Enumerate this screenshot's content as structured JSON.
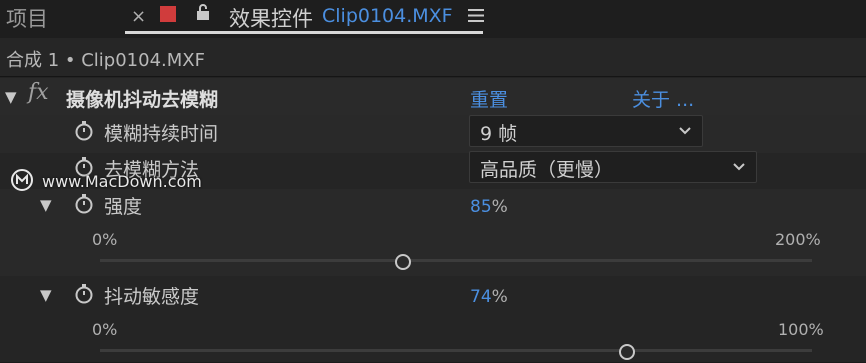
{
  "tabs": {
    "project_label": "项目",
    "close_label": "×",
    "effect_controls_label": "效果控件",
    "effect_controls_clip": "Clip0104.MXF"
  },
  "breadcrumb": "合成 1 • Clip0104.MXF",
  "effect": {
    "fx_label": "fx",
    "name": "摄像机抖动去模糊",
    "reset_label": "重置",
    "about_label": "关于 ..."
  },
  "properties": {
    "blur_duration": {
      "label": "模糊持续时间",
      "value": "9 帧"
    },
    "deblur_method": {
      "label": "去模糊方法",
      "value": "高品质（更慢）"
    },
    "strength": {
      "label": "强度",
      "value": "85",
      "unit": "%",
      "min_label": "0%",
      "max_label": "200%",
      "level_percent_of_range": 42.5
    },
    "jitter_sensitivity": {
      "label": "抖动敏感度",
      "value": "74",
      "unit": "%",
      "min_label": "0%",
      "max_label": "100%",
      "level_percent_of_range": 74
    }
  },
  "watermark": "www.MacDown.com",
  "colors": {
    "accent": "#4b8fe0",
    "background": "#232323",
    "tab_marker": "#d03c3c"
  }
}
